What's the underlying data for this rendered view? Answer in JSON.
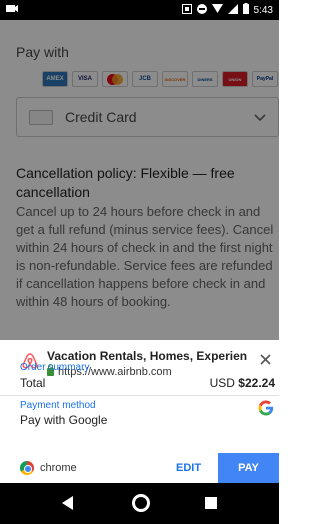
{
  "status_bar": {
    "time": "5:43"
  },
  "background": {
    "pay_with_label": "Pay with",
    "payment_logos": [
      "AMEX",
      "VISA",
      "MC",
      "JCB",
      "DISCOVER",
      "DINERS",
      "UNION",
      "PayPal"
    ],
    "card_select_label": "Credit Card",
    "policy_title": "Cancellation policy: Flexible — free cancellation",
    "policy_text": "Cancel up to 24 hours before check in and get a full refund (minus service fees). Cancel within 24 hours of check in and the first night is non-refundable. Service fees are refunded if cancellation happens before check in and within 48 hours of booking."
  },
  "sheet": {
    "merchant_name": "Vacation Rentals, Homes, Experiences &...",
    "merchant_url": "https://www.airbnb.com",
    "order_summary_label": "Order summary",
    "total_label": "Total",
    "total_currency": "USD",
    "total_amount": "$22.24",
    "payment_method_label": "Payment method",
    "payment_method_value": "Pay with Google",
    "browser_label": "chrome",
    "edit_label": "EDIT",
    "pay_label": "PAY"
  },
  "colors": {
    "accent": "#4285f4",
    "link": "#1a73e8",
    "airbnb": "#ff5a5f"
  }
}
